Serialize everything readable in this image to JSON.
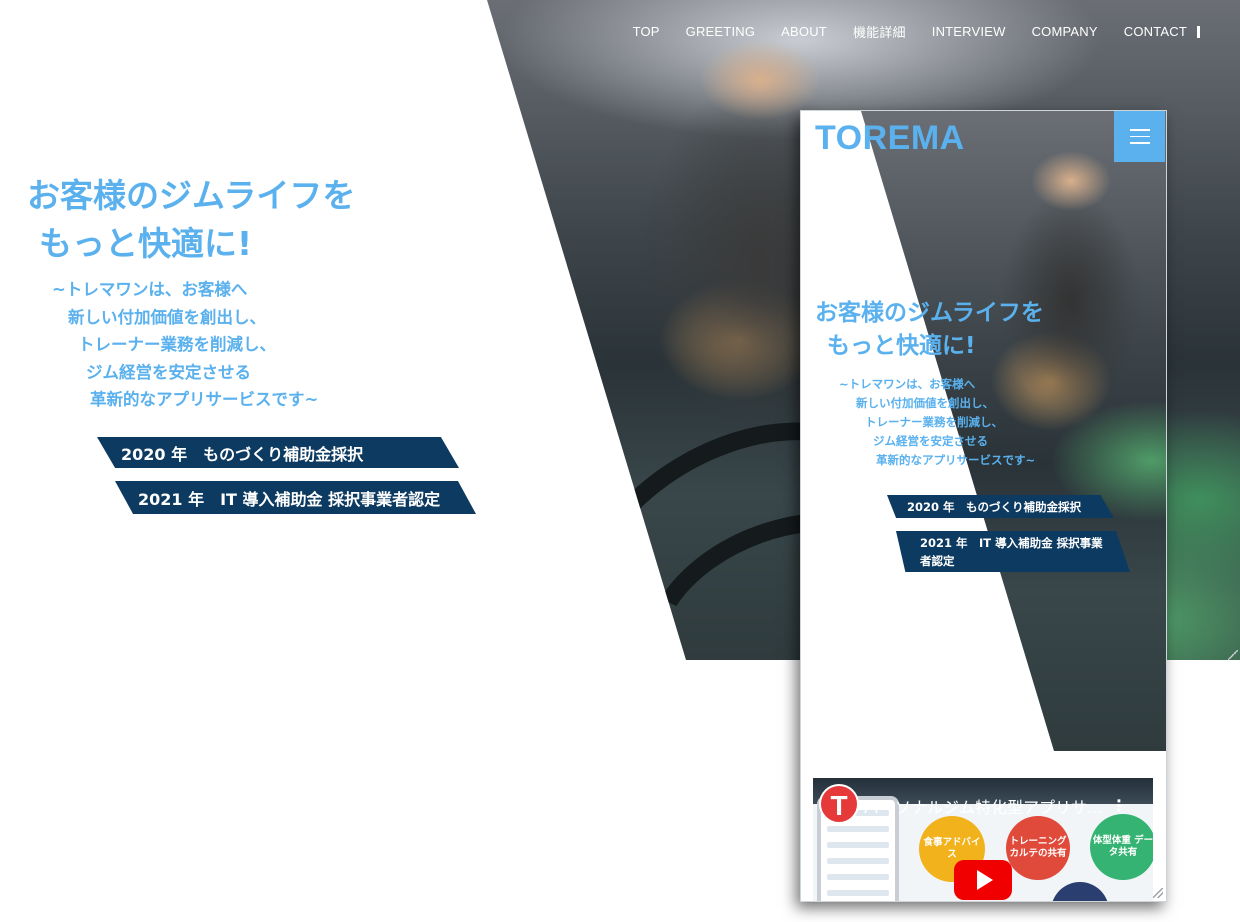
{
  "nav": {
    "items": [
      "TOP",
      "GREETING",
      "ABOUT",
      "機能詳細",
      "INTERVIEW",
      "COMPANY",
      "CONTACT"
    ]
  },
  "hero": {
    "title_line1": "お客様のジムライフを",
    "title_line2": "もっと快適に!",
    "sub_lines": [
      "~トレマワンは、お客様へ",
      "新しい付加価値を創出し、",
      "トレーナー業務を削減し、",
      "ジム経営を安定させる",
      "革新的なアプリサービスです~"
    ],
    "badges": [
      "2020 年　ものづくり補助金採択",
      "2021 年　IT 導入補助金 採択事業者認定"
    ]
  },
  "phone": {
    "logo": "TOREMA",
    "menu_icon": "hamburger-icon",
    "title_line1": "お客様のジムライフを",
    "title_line2": "もっと快適に!",
    "sub_lines": [
      "~トレマワンは、お客様へ",
      "新しい付加価値を創出し、",
      "トレーナー業務を削減し、",
      "ジム経営を安定させる",
      "革新的なアプリサービスです~"
    ],
    "badges": [
      "2020 年　ものづくり補助金採択",
      "2021 年　IT 導入補助金 採択事業者認定"
    ],
    "video": {
      "channel_logo": "T",
      "title": "パーソナルジム特化型アプリサ...",
      "features": [
        "食事アドバイス",
        "トレーニング カルテの共有",
        "体型体重 データ共有"
      ]
    }
  },
  "colors": {
    "accent": "#5ab1ee",
    "badge_bg": "#0d3a60",
    "play_red": "#f00000"
  }
}
